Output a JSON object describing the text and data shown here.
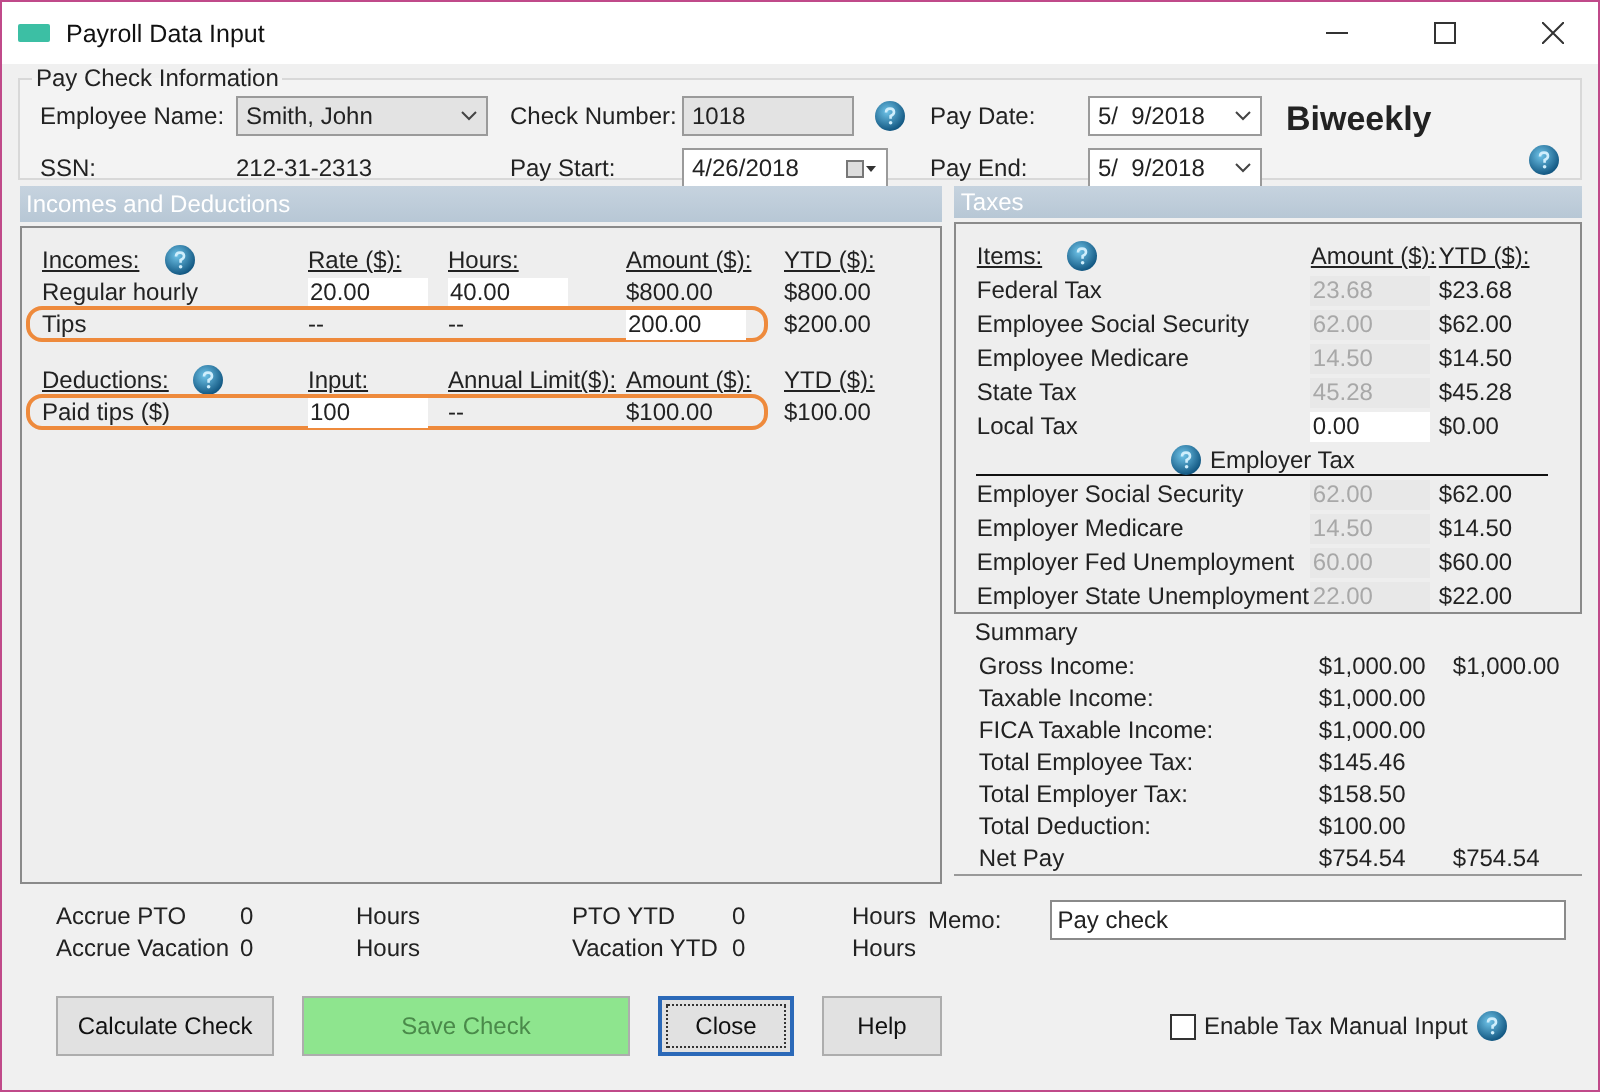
{
  "window": {
    "title": "Payroll Data Input"
  },
  "pay_check_info": {
    "title": "Pay Check Information",
    "employee_label": "Employee Name:",
    "employee_value": "Smith, John",
    "ssn_label": "SSN:",
    "ssn_value": "212-31-2313",
    "check_number_label": "Check Number:",
    "check_number_value": "1018",
    "pay_start_label": "Pay Start:",
    "pay_start_value": "4/26/2018",
    "pay_date_label": "Pay Date:",
    "pay_date_value": "5/  9/2018",
    "pay_end_label": "Pay End:",
    "pay_end_value": "5/  9/2018",
    "frequency": "Biweekly"
  },
  "incomes_panel": {
    "title": "Incomes and Deductions",
    "incomes": {
      "headers": [
        "Incomes:",
        "Rate ($):",
        "Hours:",
        "Amount ($):",
        "YTD ($):"
      ],
      "rows": [
        {
          "label": "Regular hourly",
          "col2": "20.00",
          "col2_input": true,
          "col3": "40.00",
          "col3_input": true,
          "amount": "$800.00",
          "amount_input": false,
          "ytd": "$800.00",
          "highlighted": false
        },
        {
          "label": "Tips",
          "col2": "--",
          "col2_input": false,
          "col3": "--",
          "col3_input": false,
          "amount": "200.00",
          "amount_input": true,
          "ytd": "$200.00",
          "highlighted": true
        }
      ]
    },
    "deductions": {
      "headers": [
        "Deductions:",
        "Input:",
        "Annual Limit($):",
        "Amount ($):",
        "YTD ($):"
      ],
      "rows": [
        {
          "label": "Paid tips  ($)",
          "col2": "100",
          "col2_input": true,
          "col3": "--",
          "col3_input": false,
          "amount": "$100.00",
          "amount_input": false,
          "ytd": "$100.00",
          "highlighted": true
        }
      ]
    }
  },
  "taxes_panel": {
    "title": "Taxes",
    "headers": [
      "Items:",
      "Amount ($):",
      "YTD ($):"
    ],
    "employee_rows": [
      {
        "label": "Federal Tax",
        "amount": "23.68",
        "disabled": true,
        "ytd": "$23.68"
      },
      {
        "label": "Employee Social Security",
        "amount": "62.00",
        "disabled": true,
        "ytd": "$62.00"
      },
      {
        "label": "Employee Medicare",
        "amount": "14.50",
        "disabled": true,
        "ytd": "$14.50"
      },
      {
        "label": "State Tax",
        "amount": "45.28",
        "disabled": true,
        "ytd": "$45.28"
      },
      {
        "label": "Local Tax",
        "amount": "0.00",
        "disabled": false,
        "ytd": "$0.00"
      }
    ],
    "employer_title": "Employer Tax",
    "employer_rows": [
      {
        "label": "Employer Social Security",
        "amount": "62.00",
        "disabled": true,
        "ytd": "$62.00"
      },
      {
        "label": "Employer Medicare",
        "amount": "14.50",
        "disabled": true,
        "ytd": "$14.50"
      },
      {
        "label": "Employer Fed Unemployment",
        "amount": "60.00",
        "disabled": true,
        "ytd": "$60.00"
      },
      {
        "label": "Employer State Unemployment",
        "amount": "22.00",
        "disabled": true,
        "ytd": "$22.00"
      }
    ]
  },
  "summary": {
    "title": "Summary",
    "rows": [
      {
        "label": "Gross Income:",
        "value": "$1,000.00",
        "ytd": "$1,000.00"
      },
      {
        "label": "Taxable Income:",
        "value": "$1,000.00"
      },
      {
        "label": "FICA Taxable Income:",
        "value": "$1,000.00"
      },
      {
        "label": "Total Employee Tax:",
        "value": "$145.46"
      },
      {
        "label": "Total Employer Tax:",
        "value": "$158.50"
      },
      {
        "label": "Total Deduction:",
        "value": "$100.00"
      },
      {
        "label": "Net Pay",
        "value": "$754.54",
        "ytd": "$754.54"
      }
    ]
  },
  "accruals": [
    {
      "label": "Accrue PTO",
      "value": "0",
      "unit": "Hours",
      "ytd_label": "PTO YTD",
      "ytd_value": "0",
      "ytd_unit": "Hours"
    },
    {
      "label": "Accrue Vacation",
      "value": "0",
      "unit": "Hours",
      "ytd_label": "Vacation YTD",
      "ytd_value": "0",
      "ytd_unit": "Hours"
    }
  ],
  "memo": {
    "label": "Memo:",
    "value": "Pay check"
  },
  "buttons": [
    {
      "label": "Calculate Check",
      "kind": "normal"
    },
    {
      "label": "Save Check",
      "kind": "save"
    },
    {
      "label": "Close",
      "kind": "focused"
    },
    {
      "label": "Help",
      "kind": "normal"
    }
  ],
  "manual_input": {
    "label": "Enable Tax Manual Input",
    "checked": false
  }
}
